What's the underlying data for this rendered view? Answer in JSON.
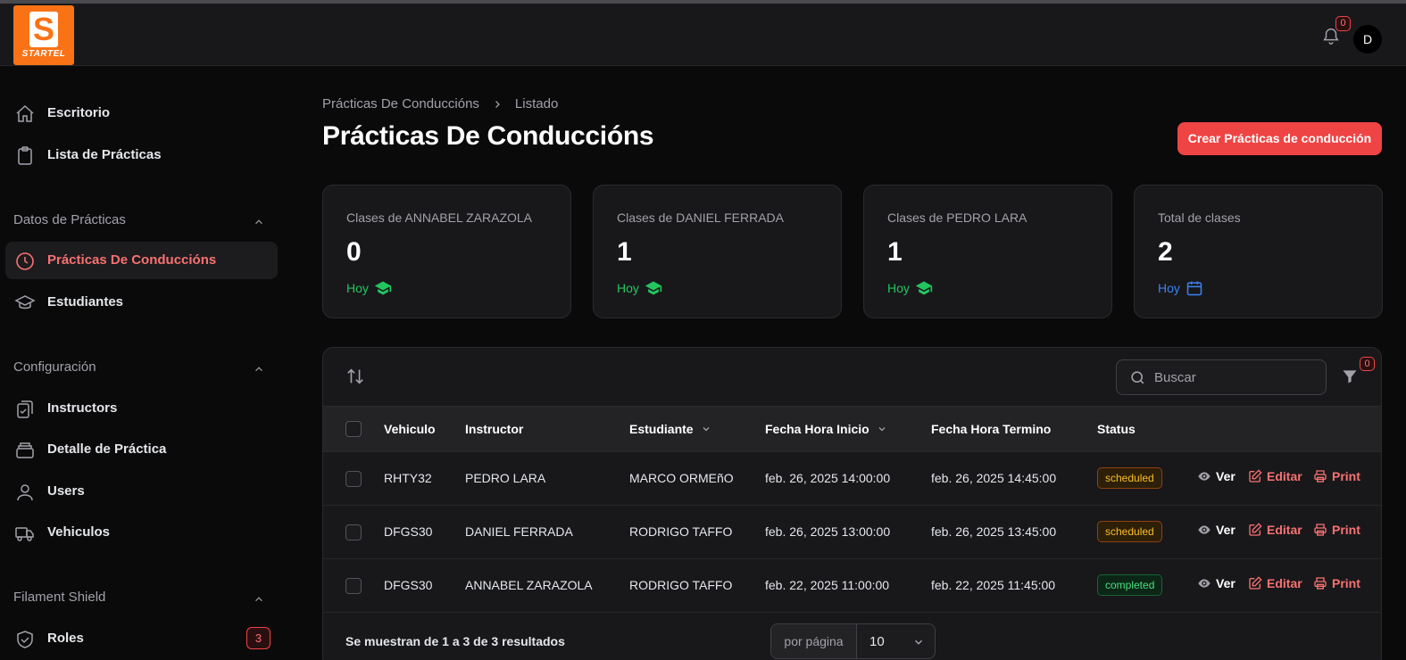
{
  "topbar": {
    "logo_text": "STARTEL",
    "logo_letter": "S",
    "notifications_count": "0",
    "avatar_initial": "D"
  },
  "sidebar": {
    "top_items": [
      {
        "label": "Escritorio",
        "icon": "home-icon"
      },
      {
        "label": "Lista de Prácticas",
        "icon": "clipboard-icon"
      }
    ],
    "groups": [
      {
        "label": "Datos de Prácticas",
        "items": [
          {
            "label": "Prácticas De Conducciónes",
            "icon": "clock-icon",
            "active": true
          },
          {
            "label": "Estudiantes",
            "icon": "graduation-cap-icon"
          }
        ]
      },
      {
        "label": "Configuración",
        "items": [
          {
            "label": "Instructors",
            "icon": "clipboard-check-icon"
          },
          {
            "label": "Detalle de Práctica",
            "icon": "archive-icon"
          },
          {
            "label": "Users",
            "icon": "user-icon"
          },
          {
            "label": "Vehiculos",
            "icon": "truck-icon"
          }
        ]
      },
      {
        "label": "Filament Shield",
        "items": [
          {
            "label": "Roles",
            "icon": "shield-check-icon",
            "badge": "3"
          }
        ]
      }
    ]
  },
  "breadcrumb": {
    "parent": "Prácticas De Conduccións",
    "current": "Listado"
  },
  "page": {
    "title": "Prácticas De Conduccións",
    "create_button": "Crear Prácticas de conducción"
  },
  "stats": [
    {
      "label": "Clases de ANNABEL ZARAZOLA",
      "value": "0",
      "desc": "Hoy",
      "color": "#22c55e",
      "icon": "graduation-cap-icon"
    },
    {
      "label": "Clases de DANIEL FERRADA",
      "value": "1",
      "desc": "Hoy",
      "color": "#22c55e",
      "icon": "graduation-cap-icon"
    },
    {
      "label": "Clases de PEDRO LARA",
      "value": "1",
      "desc": "Hoy",
      "color": "#22c55e",
      "icon": "graduation-cap-icon"
    },
    {
      "label": "Total de clases",
      "value": "2",
      "desc": "Hoy",
      "color": "#3b82f6",
      "icon": "calendar-icon"
    }
  ],
  "table": {
    "search_placeholder": "Buscar",
    "filter_count": "0",
    "columns": [
      "Vehiculo",
      "Instructor",
      "Estudiante",
      "Fecha Hora Inicio",
      "Fecha Hora Termino",
      "Status"
    ],
    "rows": [
      {
        "vehiculo": "RHTY32",
        "instructor": "PEDRO LARA",
        "estudiante": "MARCO ORMEñO",
        "inicio": "feb. 26, 2025 14:00:00",
        "termino": "feb. 26, 2025 14:45:00",
        "status": "scheduled"
      },
      {
        "vehiculo": "DFGS30",
        "instructor": "DANIEL FERRADA",
        "estudiante": "RODRIGO TAFFO",
        "inicio": "feb. 26, 2025 13:00:00",
        "termino": "feb. 26, 2025 13:45:00",
        "status": "scheduled"
      },
      {
        "vehiculo": "DFGS30",
        "instructor": "ANNABEL ZARAZOLA",
        "estudiante": "RODRIGO TAFFO",
        "inicio": "feb. 22, 2025 11:00:00",
        "termino": "feb. 22, 2025 11:45:00",
        "status": "completed"
      }
    ],
    "actions": {
      "view": "Ver",
      "edit": "Editar",
      "print": "Print"
    },
    "footer_text": "Se muestran de 1 a 3 de 3 resultados",
    "per_page_label": "por página",
    "per_page_value": "10"
  }
}
